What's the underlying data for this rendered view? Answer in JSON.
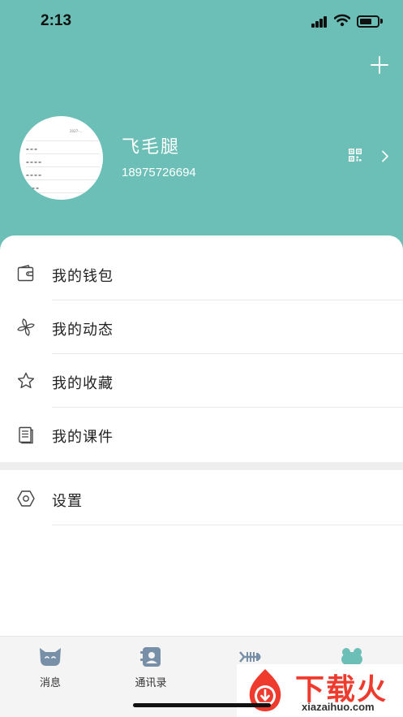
{
  "status_bar": {
    "time": "2:13",
    "battery_level": 0.7
  },
  "header": {
    "add_icon": "plus-icon"
  },
  "profile": {
    "name": "飞毛腿",
    "phone": "18975726694",
    "qr_icon": "qr-code-icon",
    "chevron_icon": "chevron-right-icon"
  },
  "menu": {
    "items": [
      {
        "label": "我的钱包",
        "icon": "wallet-icon"
      },
      {
        "label": "我的动态",
        "icon": "pinwheel-icon"
      },
      {
        "label": "我的收藏",
        "icon": "star-icon"
      },
      {
        "label": "我的课件",
        "icon": "document-icon"
      }
    ],
    "settings": {
      "label": "设置",
      "icon": "hexagon-settings-icon"
    }
  },
  "tabbar": {
    "tabs": [
      {
        "label": "消息",
        "icon": "cat-face-icon"
      },
      {
        "label": "通讯录",
        "icon": "contacts-book-icon"
      },
      {
        "label": "",
        "icon": "fish-bone-icon"
      },
      {
        "label": "",
        "icon": "frog-icon",
        "active": true
      }
    ]
  },
  "watermark": {
    "title": "下载火",
    "subtitle": "xiazaihuo.com"
  },
  "colors": {
    "header_bg": "#6cbfb6",
    "tab_icon": "#7790a8",
    "active_tab_icon": "#6cbfb6",
    "watermark_red": "#ef3b2d"
  }
}
